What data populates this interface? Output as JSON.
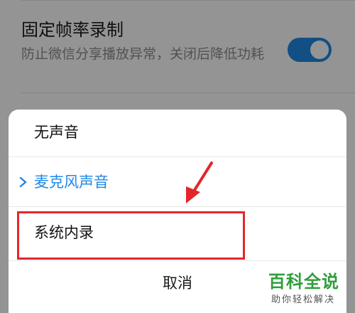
{
  "setting": {
    "title": "固定帧率录制",
    "description": "防止微信分享播放异常，关闭后降低功耗",
    "toggle_on": true
  },
  "dialog": {
    "options": [
      {
        "label": "无声音",
        "selected": false
      },
      {
        "label": "麦克风声音",
        "selected": true
      },
      {
        "label": "系统内录",
        "selected": false
      }
    ],
    "cancel_label": "取消"
  },
  "annotation": {
    "highlighted_option": "系统内录",
    "color": "#e3262b"
  },
  "watermark": {
    "title": "百科全说",
    "subtitle": "助你轻松解决"
  },
  "colors": {
    "accent": "#1e88e5",
    "watermark_green": "#2e9e3a"
  }
}
